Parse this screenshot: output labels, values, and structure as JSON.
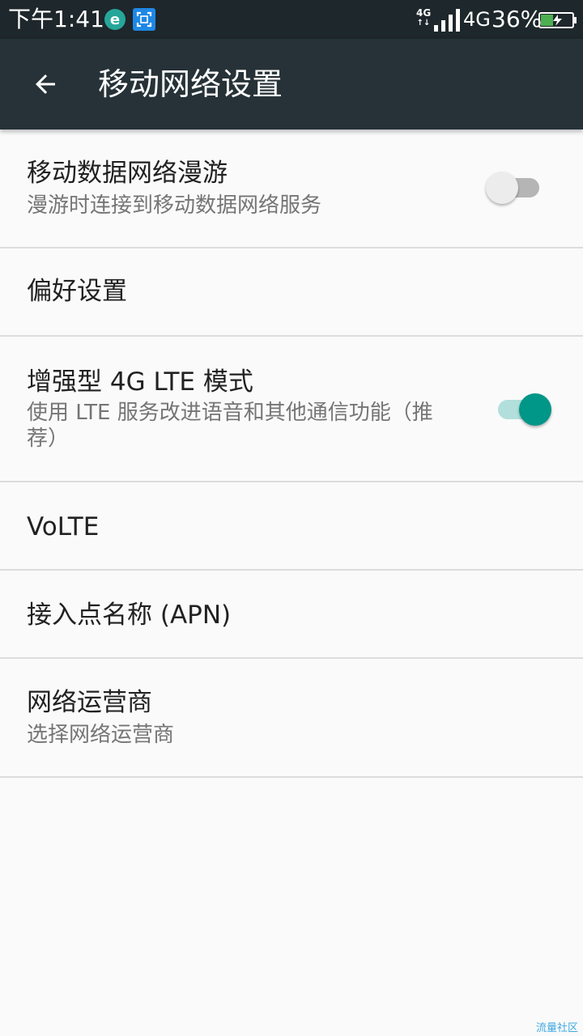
{
  "status_bar": {
    "time": "下午1:41",
    "network_small": "4G",
    "network_type": "4G",
    "battery_percent": "36%",
    "icons": [
      "browser-notification-icon",
      "screenshot-notification-icon",
      "signal-icon",
      "battery-charging-icon"
    ]
  },
  "toolbar": {
    "back_icon": "arrow-back-icon",
    "title": "移动网络设置"
  },
  "settings": {
    "roaming": {
      "title": "移动数据网络漫游",
      "summary": "漫游时连接到移动数据网络服务",
      "enabled": false
    },
    "preferences": {
      "title": "偏好设置"
    },
    "lte": {
      "title": "增强型 4G LTE 模式",
      "summary": "使用 LTE 服务改进语音和其他通信功能（推荐）",
      "enabled": true
    },
    "volte": {
      "title": "VoLTE"
    },
    "apn": {
      "title": "接入点名称 (APN)"
    },
    "carrier": {
      "title": "网络运营商",
      "summary": "选择网络运营商"
    }
  },
  "watermark": "流量社区",
  "colors": {
    "status_bar": "#1e272b",
    "toolbar": "#263238",
    "background": "#fafafa",
    "accent": "#009688",
    "accent_track": "#b2dfdb",
    "divider": "#dcdcdc"
  }
}
